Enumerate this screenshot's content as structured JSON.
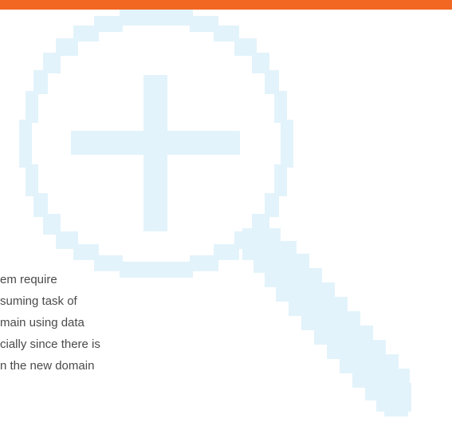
{
  "colors": {
    "top_bar": "#f26722",
    "magnifier": "#e3f3fb",
    "text": "#4a4a4a"
  },
  "decoration": {
    "icon": "magnifier-plus-icon"
  },
  "paragraph": {
    "lines": [
      "em require",
      "suming task of",
      "main using data",
      "cially since there is",
      "n the new domain"
    ]
  }
}
